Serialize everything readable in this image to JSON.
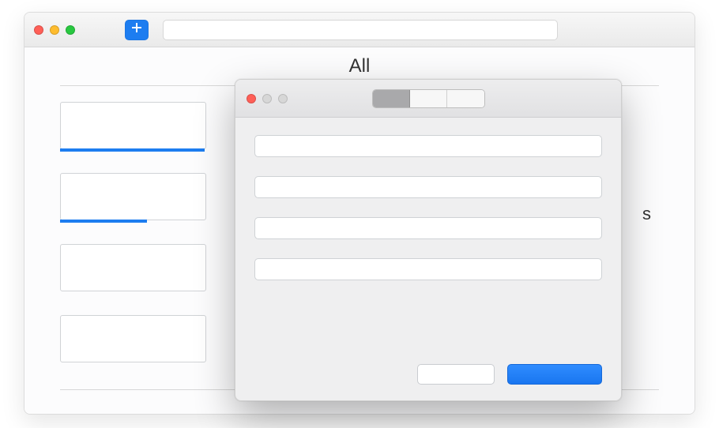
{
  "main_window": {
    "traffic": [
      "red",
      "yellow",
      "green"
    ],
    "add_button_icon": "plus-icon",
    "address_value": "",
    "page_title": "All",
    "sidebar_letter": "s",
    "cards": [
      {
        "label": "",
        "progress_pct": 100
      },
      {
        "label": "",
        "progress_pct": 60
      },
      {
        "label": "",
        "progress_pct": 0
      },
      {
        "label": "",
        "progress_pct": 0
      }
    ]
  },
  "modal": {
    "traffic": [
      "red",
      "gray",
      "gray"
    ],
    "segments": [
      {
        "label": "",
        "selected": true
      },
      {
        "label": "",
        "selected": false
      },
      {
        "label": "",
        "selected": false
      }
    ],
    "fields": [
      {
        "placeholder": "",
        "value": ""
      },
      {
        "placeholder": "",
        "value": ""
      },
      {
        "placeholder": "",
        "value": ""
      },
      {
        "placeholder": "",
        "value": ""
      }
    ],
    "buttons": {
      "secondary_label": "",
      "primary_label": ""
    }
  },
  "colors": {
    "accent": "#1d7df0"
  }
}
